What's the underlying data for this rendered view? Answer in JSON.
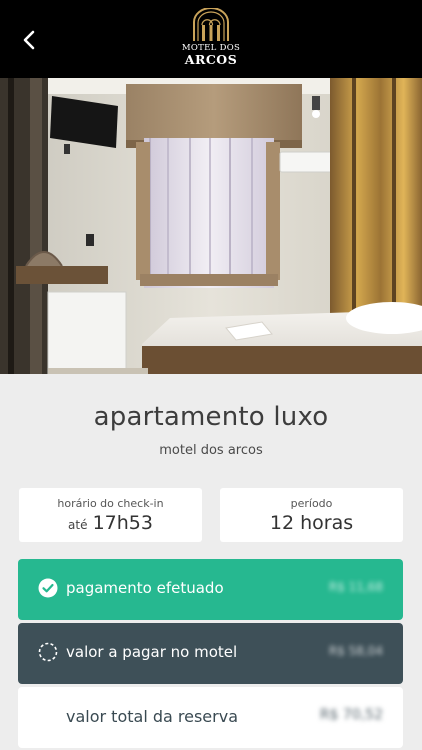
{
  "header": {
    "back_icon": "chevron-left-icon",
    "logo_line1": "MOTEL DOS",
    "logo_line2": "ARCOS"
  },
  "hero": {
    "description_icon": "room-photo"
  },
  "room": {
    "title": "apartamento luxo",
    "subtitle": "motel dos arcos"
  },
  "checkin": {
    "label": "horário do check-in",
    "prefix": "até",
    "value": "17h53"
  },
  "period": {
    "label": "período",
    "value": "12 horas"
  },
  "payment_rows": [
    {
      "label": "pagamento efetuado",
      "amount": "R$ 11,68",
      "icon": "check-circle-icon",
      "color": "#26b890"
    },
    {
      "label": "valor a pagar no motel",
      "amount": "R$ 58,04",
      "icon": "dashed-circle-icon",
      "color": "#3e5058"
    },
    {
      "label": "valor total da reserva",
      "amount": "R$ 70,52",
      "icon": "",
      "color": "#ffffff"
    }
  ],
  "colors": {
    "header_bg": "#000000",
    "page_bg": "#ededed",
    "accent_paid": "#26b890",
    "accent_pending": "#3e5058"
  }
}
